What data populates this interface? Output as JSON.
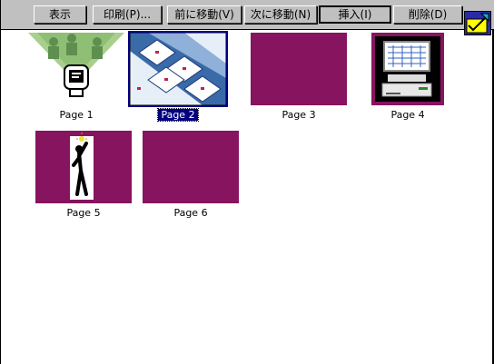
{
  "toolbar": {
    "buttons": [
      {
        "label": "表示"
      },
      {
        "label": "印刷(P)..."
      },
      {
        "label": "前に移動(V)"
      },
      {
        "label": "次に移動(N)"
      },
      {
        "label": "挿入(I)"
      },
      {
        "label": "削除(D)"
      }
    ],
    "app_icon": "pencil-check-icon"
  },
  "pages": [
    {
      "label": "Page 1",
      "thumbnail": "people-computer-spotlight",
      "selected": false
    },
    {
      "label": "Page 2",
      "thumbnail": "tiled-documents-pattern",
      "selected": true
    },
    {
      "label": "Page 3",
      "thumbnail": "blank-purple",
      "selected": false
    },
    {
      "label": "Page 4",
      "thumbnail": "computer-on-purple",
      "selected": false
    },
    {
      "label": "Page 5",
      "thumbnail": "figure-with-lightbulb",
      "selected": false
    },
    {
      "label": "Page 6",
      "thumbnail": "blank-purple",
      "selected": false
    }
  ],
  "colors": {
    "toolbar_bg": "#c0c0c0",
    "thumb_purple": "#86145e",
    "selection": "#000080"
  }
}
